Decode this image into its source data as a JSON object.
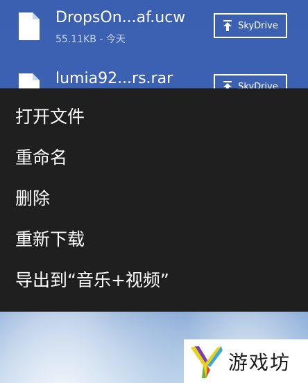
{
  "files": [
    {
      "name": "DropsOn...af.ucw",
      "meta": "55.11KB - 今天",
      "button_label": "SkyDrive",
      "icon": "document-icon"
    },
    {
      "name": "lumia92...rs.rar",
      "button_label": "SkyDrive",
      "icon": "document-icon"
    }
  ],
  "context_menu": {
    "items": [
      {
        "label": "打开文件"
      },
      {
        "label": "重命名"
      },
      {
        "label": "删除"
      },
      {
        "label": "重新下载"
      },
      {
        "label": "导出到“音乐+视频”"
      }
    ]
  },
  "watermark": {
    "text": "游戏坊"
  },
  "colors": {
    "header_blue": "#3b5fb1",
    "menu_background": "#1f1f1f",
    "text_primary": "#ffffff",
    "text_secondary": "#c9d6ef"
  }
}
